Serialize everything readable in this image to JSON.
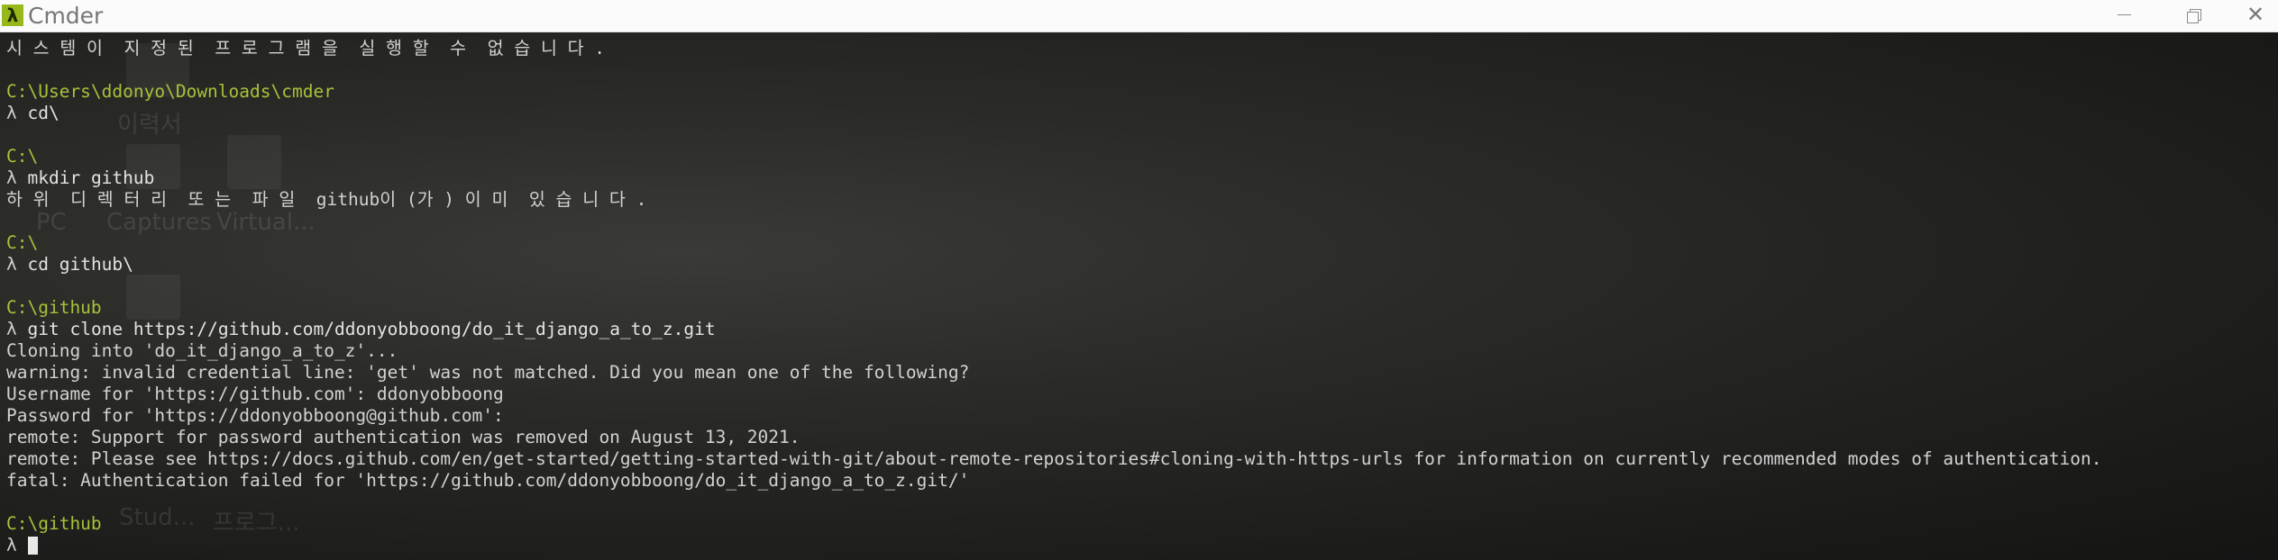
{
  "window": {
    "title": "Cmder",
    "app_icon_glyph": "λ",
    "close_glyph": "✕"
  },
  "desktop_ghost": {
    "labels": [
      "이력서",
      "PC",
      "Captures",
      "Virtual...",
      "Stud...",
      "프로그..."
    ]
  },
  "terminal": {
    "prompt_symbol": "λ",
    "lines": [
      {
        "kind": "output",
        "text": "시 스 템 이  지 정 된  프 로 그 램 을  실 행 할  수  없 습 니 다 ."
      },
      {
        "kind": "blank",
        "text": ""
      },
      {
        "kind": "path",
        "text": "C:\\Users\\ddonyo\\Downloads\\cmder"
      },
      {
        "kind": "command",
        "text": "cd\\"
      },
      {
        "kind": "blank",
        "text": ""
      },
      {
        "kind": "path",
        "text": "C:\\"
      },
      {
        "kind": "command",
        "text": "mkdir github"
      },
      {
        "kind": "output",
        "text": "하 위  디 렉 터 리  또 는  파 일  github이 (가 ) 이 미  있 습 니 다 ."
      },
      {
        "kind": "blank",
        "text": ""
      },
      {
        "kind": "path",
        "text": "C:\\"
      },
      {
        "kind": "command",
        "text": "cd github\\"
      },
      {
        "kind": "blank",
        "text": ""
      },
      {
        "kind": "path",
        "text": "C:\\github"
      },
      {
        "kind": "command",
        "text": "git clone https://github.com/ddonyobboong/do_it_django_a_to_z.git"
      },
      {
        "kind": "output",
        "text": "Cloning into 'do_it_django_a_to_z'..."
      },
      {
        "kind": "output",
        "text": "warning: invalid credential line: 'get' was not matched. Did you mean one of the following?"
      },
      {
        "kind": "output",
        "text": "Username for 'https://github.com': ddonyobboong"
      },
      {
        "kind": "output",
        "text": "Password for 'https://ddonyobboong@github.com':"
      },
      {
        "kind": "output",
        "text": "remote: Support for password authentication was removed on August 13, 2021."
      },
      {
        "kind": "output",
        "text": "remote: Please see https://docs.github.com/en/get-started/getting-started-with-git/about-remote-repositories#cloning-with-https-urls for information on currently recommended modes of authentication."
      },
      {
        "kind": "output",
        "text": "fatal: Authentication failed for 'https://github.com/ddonyobboong/do_it_django_a_to_z.git/'"
      },
      {
        "kind": "blank",
        "text": ""
      },
      {
        "kind": "path",
        "text": "C:\\github"
      },
      {
        "kind": "prompt",
        "text": ""
      }
    ]
  },
  "colors": {
    "path": "#a7c23a",
    "text": "#dcdcdc",
    "background": "#1f1f1d",
    "titlebar": "#fbfbfb",
    "icon_accent": "#97b81a"
  }
}
